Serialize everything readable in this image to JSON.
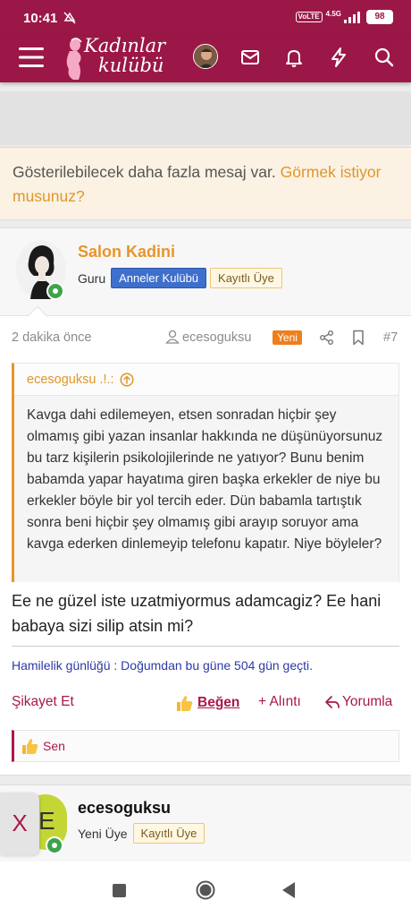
{
  "status_bar": {
    "time": "10:41",
    "network": "4.5G",
    "volte": "VoLTE",
    "battery": "98"
  },
  "app_bar": {
    "logo_line1": "Kadınlar",
    "logo_line2": "kulübü",
    "icons": [
      "menu-icon",
      "avatar",
      "mail-icon",
      "bell-icon",
      "bolt-icon",
      "search-icon"
    ]
  },
  "notice": {
    "text": "Gösterilebilecek daha fazla mesaj var.",
    "link": "Görmek istiyor musunuz?"
  },
  "post": {
    "username": "Salon Kadini",
    "rank": "Guru",
    "badges": [
      "Anneler Kulübü",
      "Kayıtlı Üye"
    ],
    "time": "2 dakika önce",
    "thread_author": "ecesoguksu",
    "new_label": "Yeni",
    "number": "#7",
    "quote": {
      "author": "ecesoguksu .!.:",
      "text": "Kavga dahi edilemeyen, etsen sonradan hiçbir şey olmamış gibi yazan insanlar hakkında ne düşünüyorsunuz bu tarz kişilerin psikolojilerinde ne yatıyor? Bunu benim babamda yapar hayatıma giren başka erkekler de niye bu erkekler böyle bir yol tercih eder. Dün babamla tartıştık sonra beni hiçbir şey olmamış gibi arayıp soruyor ama kavga ederken dinlemeyip telefonu kapatır. Niye böyleler?"
    },
    "body": "Ee ne güzel iste uzatmiyormus adamcagiz? Ee hani babaya sizi silip atsin mi?",
    "signature": "Hamilelik günlüğü : Doğumdan bu güne 504 gün geçti.",
    "actions": {
      "report": "Şikayet Et",
      "like": "Beğen",
      "quote": "+ Alıntı",
      "reply": "Yorumla"
    },
    "reactions": "Sen"
  },
  "next_post": {
    "username": "ecesoguksu",
    "avatar_letter": "E",
    "rank": "Yeni Üye",
    "badge": "Kayıtlı Üye"
  },
  "close_button": "X",
  "colors": {
    "brand": "#9b1747",
    "accent": "#e8952a",
    "link_accent": "#a9184b",
    "badge_blue": "#3f6fcc",
    "new_badge": "#ee7f1c",
    "online": "#3ea34a"
  }
}
